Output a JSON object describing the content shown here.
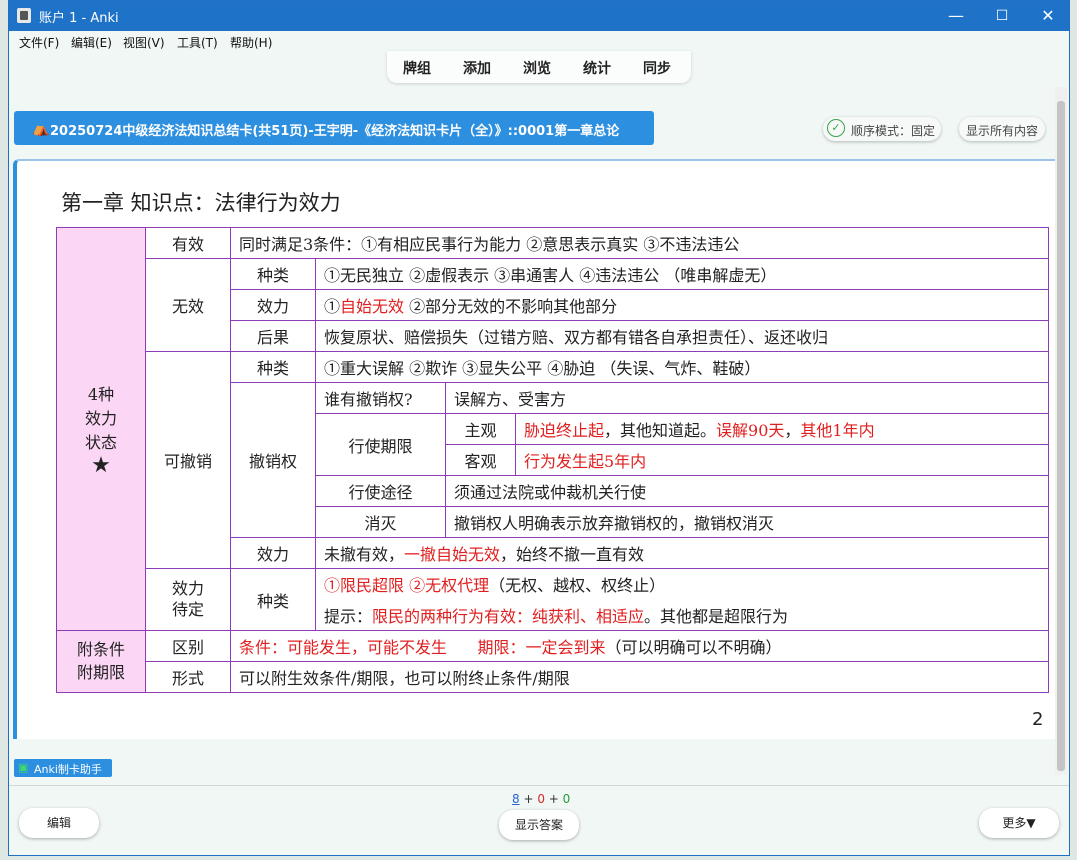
{
  "window": {
    "title": "账户 1 - Anki",
    "minimize": "—",
    "maximize": "☐",
    "close": "✕"
  },
  "menu": [
    "文件(F)",
    "编辑(E)",
    "视图(V)",
    "工具(T)",
    "帮助(H)"
  ],
  "toolbar": [
    "牌组",
    "添加",
    "浏览",
    "统计",
    "同步"
  ],
  "deck": {
    "icon": "⛺",
    "name": "20250724中级经济法知识总结卡(共51页)-王宇明-《经济法知识卡片（全）》::0001第一章总论"
  },
  "order_mode": {
    "icon": "✓",
    "label": "顺序模式：固定"
  },
  "show_all": "显示所有内容",
  "card": {
    "heading": "第一章  知识点：法律行为效力",
    "page": "2",
    "states_label_1": "4种",
    "states_label_2": "效力",
    "states_label_3": "状态",
    "star": "★",
    "cond_label_1": "附条件",
    "cond_label_2": "附期限",
    "valid_label": "有效",
    "valid_text": "同时满足3条件：①有相应民事行为能力 ②意思表示真实 ③不违法违公",
    "void_label": "无效",
    "void_kind_label": "种类",
    "void_kind_text": "①无民独立 ②虚假表示 ③串通害人 ④违法违公  （唯串解虚无）",
    "void_effect_label": "效力",
    "void_effect_a": "①",
    "void_effect_b": "自始无效",
    "void_effect_c": " ②部分无效的不影响其他部分",
    "void_result_label": "后果",
    "void_result_text": "恢复原状、赔偿损失（过错方赔、双方都有错各自承担责任）、返还收归",
    "revoc_label": "可撤销",
    "revoc_kind_label": "种类",
    "revoc_kind_text": "①重大误解 ②欺诈 ③显失公平 ④胁迫  （失误、气炸、鞋破）",
    "right_label": "撤销权",
    "who_label": "谁有撤销权?",
    "who_text": "误解方、受害方",
    "period_label": "行使期限",
    "subj_label": "主观",
    "subj_a": "胁迫终止起",
    "subj_b": "，其他知道起。",
    "subj_c": "误解90天",
    "subj_d": "，",
    "subj_e": "其他1年内",
    "obj_label": "客观",
    "obj_text": "行为发生起5年内",
    "way_label": "行使途径",
    "way_text": "须通过法院或仲裁机关行使",
    "extinct_label": "消灭",
    "extinct_text": "撤销权人明确表示放弃撤销权的，撤销权消灭",
    "revoc_effect_label": "效力",
    "revoc_effect_a": "未撤有效，",
    "revoc_effect_b": "一撤自始无效",
    "revoc_effect_c": "，始终不撤一直有效",
    "pending_label_1": "效力",
    "pending_label_2": "待定",
    "pending_kind_label": "种类",
    "pending_l1_a": "①限民超限 ②无权代理",
    "pending_l1_b": "（无权、越权、权终止）",
    "pending_l2_a": "提示：",
    "pending_l2_b": "限民的两种行为有效：纯获利、相适应",
    "pending_l2_c": "。其他都是超限行为",
    "diff_label": "区别",
    "diff_a": "条件：可能发生，可能不发生      期限：一定会到来",
    "diff_b": "（可以明确可以不明确）",
    "form_label": "形式",
    "form_text": "可以附生效条件/期限，也可以附终止条件/期限"
  },
  "helper": {
    "icon": "▣",
    "label": "Anki制卡助手"
  },
  "counts": {
    "new": "8",
    "plus1": " + ",
    "learn": "0",
    "plus2": " + ",
    "review": "0"
  },
  "buttons": {
    "edit": "编辑",
    "show_answer": "显示答案",
    "more": "更多▼"
  },
  "colors": {
    "accent": "#2d8fe0",
    "title_bar": "#1e73c8",
    "pink": "#fcd7f5",
    "border": "#8c3cb8",
    "red": "#e02020",
    "new_count": "#2a63d4",
    "learn_count": "#d42a2a",
    "review_count": "#2a9a3a"
  }
}
